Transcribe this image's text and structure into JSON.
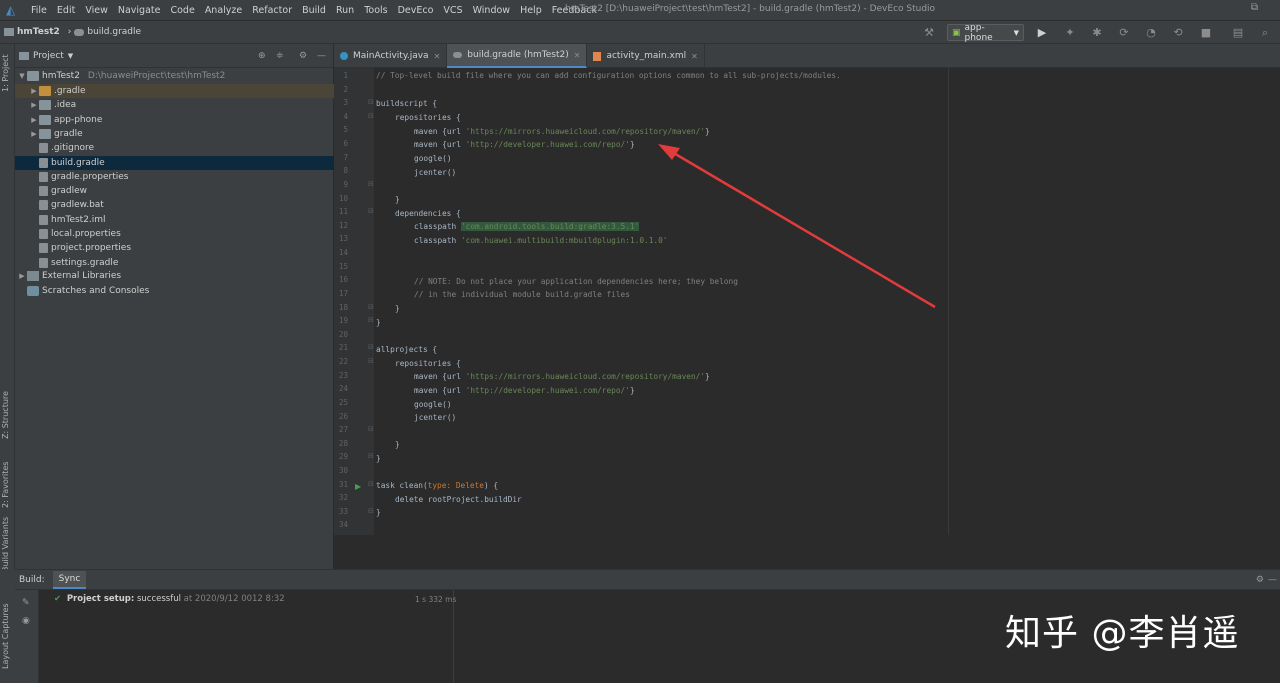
{
  "app": {
    "title": "hmTest2 [D:\\huaweiProject\\test\\hmTest2] - build.gradle (hmTest2) - DevEco Studio"
  },
  "menu": [
    "File",
    "Edit",
    "View",
    "Navigate",
    "Code",
    "Analyze",
    "Refactor",
    "Build",
    "Run",
    "Tools",
    "DevEco",
    "VCS",
    "Window",
    "Help",
    "Feedback"
  ],
  "breadcrumb": {
    "project": "hmTest2",
    "file": "build.gradle"
  },
  "run_config": "app-phone",
  "side_tabs": {
    "project": "1: Project",
    "structure": "Z: Structure",
    "favorites": "2: Favorites",
    "build_variants": "Build Variants",
    "layout_captures": "Layout Captures"
  },
  "project_panel": {
    "title": "Project",
    "root": {
      "name": "hmTest2",
      "path": "D:\\huaweiProject\\test\\hmTest2"
    },
    "items": [
      {
        "name": ".gradle",
        "type": "folder-orange",
        "expandable": true
      },
      {
        "name": ".idea",
        "type": "folder",
        "expandable": true
      },
      {
        "name": "app-phone",
        "type": "folder",
        "expandable": true
      },
      {
        "name": "gradle",
        "type": "folder",
        "expandable": true
      },
      {
        "name": ".gitignore",
        "type": "file"
      },
      {
        "name": "build.gradle",
        "type": "file",
        "selected": true
      },
      {
        "name": "gradle.properties",
        "type": "file"
      },
      {
        "name": "gradlew",
        "type": "file"
      },
      {
        "name": "gradlew.bat",
        "type": "file"
      },
      {
        "name": "hmTest2.iml",
        "type": "file"
      },
      {
        "name": "local.properties",
        "type": "file"
      },
      {
        "name": "project.properties",
        "type": "file"
      },
      {
        "name": "settings.gradle",
        "type": "file"
      }
    ],
    "external": "External Libraries",
    "scratches": "Scratches and Consoles"
  },
  "tabs": [
    {
      "label": "MainActivity.java",
      "active": false
    },
    {
      "label": "build.gradle (hmTest2)",
      "active": true
    },
    {
      "label": "activity_main.xml",
      "active": false
    }
  ],
  "code": {
    "line1": "// Top-level build file where you can add configuration options common to all sub-projects/modules.",
    "l3": "buildscript {",
    "l4": "repositories {",
    "maven_url_kw": "maven {url ",
    "maven1": "'https://mirrors.huaweicloud.com/repository/maven/'",
    "maven2": "'http://developer.huawei.com/repo/'",
    "close_brace": "}",
    "google": "google()",
    "jcenter": "jcenter()",
    "l11": "dependencies {",
    "classpath": "classpath ",
    "cp1": "'com.android.tools.build:gradle:3.5.1'",
    "cp2": "'com.huawei.multibuild:mbuildplugin:1.0.1.0'",
    "note1": "// NOTE: Do not place your application dependencies here; they belong",
    "note2": "// in the individual module build.gradle files",
    "l21": "allprojects {",
    "l31a": "task ",
    "l31b": "clean(",
    "l31c": "type: Delete",
    "l31d": ") {",
    "l32": "delete rootProject.buildDir"
  },
  "build": {
    "label": "Build:",
    "tab": "Sync",
    "status_title": "Project setup:",
    "status": "successful",
    "timestamp": "at 2020/9/12 0012 8:32",
    "duration": "1 s 332 ms"
  },
  "watermark": "知乎 @李肖遥"
}
